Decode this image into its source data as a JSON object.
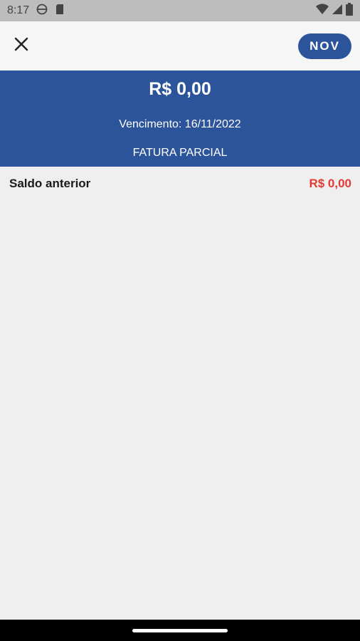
{
  "status_bar": {
    "time": "8:17",
    "icons_left": [
      "globe-crossed-icon",
      "sim-card-icon"
    ],
    "icons_right": [
      "wifi-icon",
      "cell-signal-icon",
      "battery-icon"
    ]
  },
  "top_bar": {
    "close_icon": "close-icon",
    "action_label": "NOV"
  },
  "header": {
    "amount": "R$ 0,00",
    "due": "Vencimento: 16/11/2022",
    "status": "FATURA PARCIAL"
  },
  "rows": [
    {
      "label": "Saldo anterior",
      "value": "R$ 0,00"
    }
  ],
  "colors": {
    "primary": "#2c549a",
    "negative": "#e53935",
    "background": "#efefef"
  }
}
